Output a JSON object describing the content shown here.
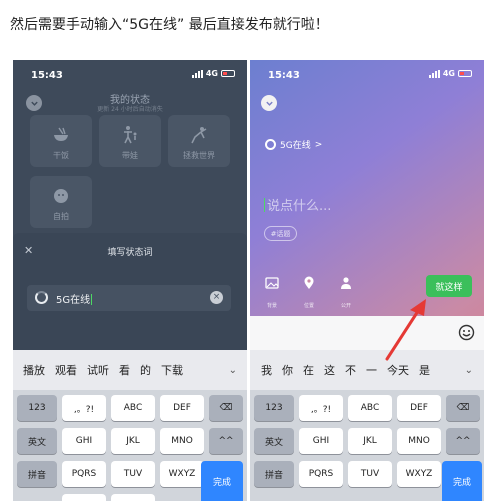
{
  "caption": "然后需要手动输入“5G在线” 最后直接发布就行啦！",
  "colors": {
    "accent_green": "#3bbf5b",
    "done_blue": "#2f86ff",
    "arrow_red": "#e53935"
  },
  "left_screen": {
    "status": {
      "time": "15:43",
      "network": "4G"
    },
    "page_title": "我的状态",
    "page_subtitle": "更新 24 小时后自动消失",
    "tiles": [
      {
        "label": "干饭",
        "icon": "bowl-icon"
      },
      {
        "label": "带娃",
        "icon": "parent-child-icon"
      },
      {
        "label": "拯救世界",
        "icon": "superhero-icon"
      },
      {
        "label": "自拍",
        "icon": "selfie-icon"
      }
    ],
    "sheet": {
      "close_label": "✕",
      "title": "填写状态词",
      "input_value": "5G在线",
      "clear_label": "×"
    },
    "keyboard": {
      "candidates": [
        "播放",
        "观看",
        "试听",
        "看",
        "的",
        "下载"
      ],
      "candidate_expand": "⌄",
      "rows": [
        [
          "123",
          ",。?!",
          "ABC",
          "DEF",
          "⌫"
        ],
        [
          "英文",
          "GHI",
          "JKL",
          "MNO",
          "^^"
        ],
        [
          "拼音",
          "PQRS",
          "TUV",
          "WXYZ"
        ]
      ],
      "done_label": "完成"
    }
  },
  "right_screen": {
    "status": {
      "time": "15:43",
      "network": "4G"
    },
    "topic": "5G在线",
    "topic_chevron": ">",
    "placeholder": "说点什么...",
    "tag_label": "#话题",
    "tools": [
      {
        "label": "背景",
        "icon": "image-icon"
      },
      {
        "label": "位置",
        "icon": "location-icon"
      },
      {
        "label": "公开",
        "icon": "person-icon"
      }
    ],
    "submit_label": "就这样",
    "keyboard": {
      "candidates": [
        "我",
        "你",
        "在",
        "这",
        "不",
        "一",
        "今天",
        "是"
      ],
      "candidate_expand": "⌄",
      "rows": [
        [
          "123",
          ",。?!",
          "ABC",
          "DEF",
          "⌫"
        ],
        [
          "英文",
          "GHI",
          "JKL",
          "MNO",
          "^^"
        ],
        [
          "拼音",
          "PQRS",
          "TUV",
          "WXYZ"
        ]
      ],
      "done_label": "完成"
    }
  }
}
